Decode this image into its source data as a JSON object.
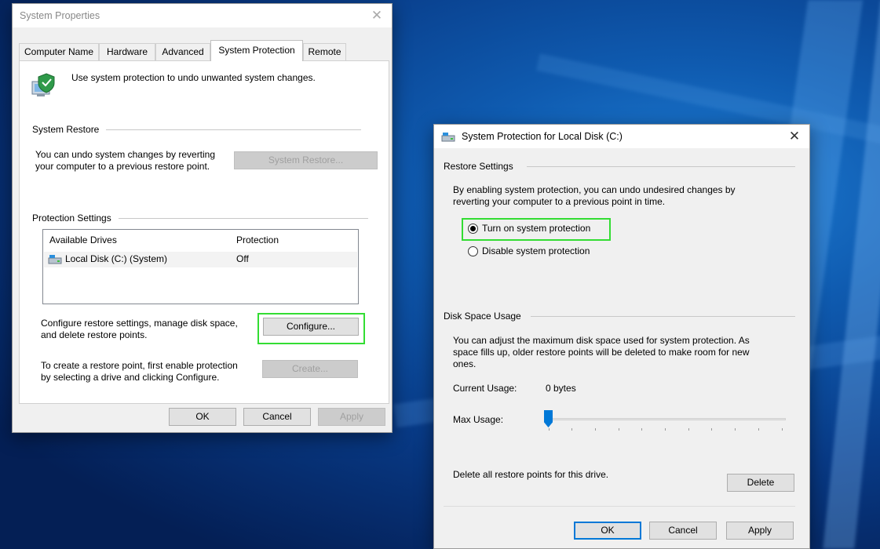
{
  "system_properties": {
    "title": "System Properties",
    "tabs": [
      "Computer Name",
      "Hardware",
      "Advanced",
      "System Protection",
      "Remote"
    ],
    "active_tab": "System Protection",
    "intro": "Use system protection to undo unwanted system changes.",
    "system_restore": {
      "heading": "System Restore",
      "text_line1": "You can undo system changes by reverting",
      "text_line2": "your computer to a previous restore point.",
      "button": "System Restore..."
    },
    "protection_settings": {
      "heading": "Protection Settings",
      "columns": [
        "Available Drives",
        "Protection"
      ],
      "rows": [
        {
          "drive": "Local Disk (C:) (System)",
          "protection": "Off"
        }
      ],
      "configure_line1": "Configure restore settings, manage disk space,",
      "configure_line2": "and delete restore points.",
      "configure_button": "Configure...",
      "create_line1": "To create a restore point, first enable protection",
      "create_line2": "by selecting a drive and clicking Configure.",
      "create_button": "Create..."
    },
    "buttons": {
      "ok": "OK",
      "cancel": "Cancel",
      "apply": "Apply"
    }
  },
  "disk_protection": {
    "title": "System Protection for Local Disk (C:)",
    "restore_settings": {
      "heading": "Restore Settings",
      "text_line1": "By enabling system protection, you can undo undesired changes by",
      "text_line2": "reverting your computer to a previous point in time.",
      "option_on": "Turn on system protection",
      "option_off": "Disable system protection",
      "selected": "on"
    },
    "disk_space": {
      "heading": "Disk Space Usage",
      "text_line1": "You can adjust the maximum disk space used for system protection. As",
      "text_line2": "space fills up, older restore points will be deleted to make room for new",
      "text_line3": "ones.",
      "current_usage_label": "Current Usage:",
      "current_usage_value": "0 bytes",
      "max_usage_label": "Max Usage:",
      "max_usage_fraction": 0.0,
      "delete_text": "Delete all restore points for this drive.",
      "delete_button": "Delete"
    },
    "buttons": {
      "ok": "OK",
      "cancel": "Cancel",
      "apply": "Apply"
    }
  },
  "colors": {
    "highlight": "#33dd33",
    "focus_blue": "#0078d7"
  }
}
